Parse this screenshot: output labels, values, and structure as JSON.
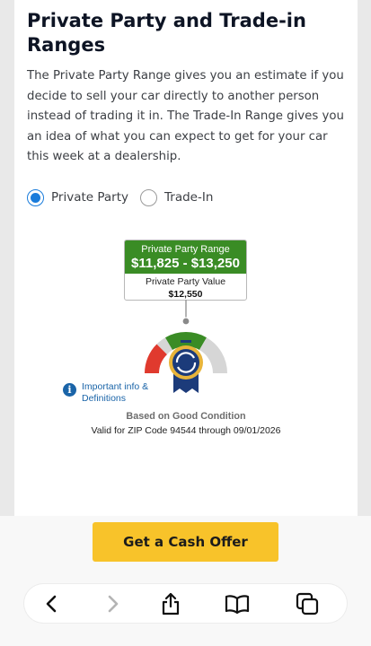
{
  "article": {
    "title": "Private Party and Trade-in Ranges",
    "description": "The Private Party Range gives you an estimate if you decide to sell your car directly to another person instead of trading it in. The Trade-In Range gives you an idea of what you can expect to get for your car this week at a dealership."
  },
  "options": [
    {
      "label": "Private Party",
      "selected": true
    },
    {
      "label": "Trade-In",
      "selected": false
    }
  ],
  "valuation": {
    "range_label": "Private Party Range",
    "range_value": "$11,825 - $13,250",
    "value_label": "Private Party Value",
    "value": "$12,550"
  },
  "info_link": "Important info & Definitions",
  "condition": "Based on Good Condition",
  "validity": "Valid for ZIP Code 94544 through 09/01/2026",
  "cta": {
    "label": "Get a Cash Offer"
  },
  "colors": {
    "range_green": "#3a8c25",
    "selected_blue": "#1a7cdb",
    "cta_yellow": "#f8c32a",
    "gauge_red": "#e03a2e",
    "gauge_green": "#3a8c25",
    "gauge_gray": "#d6d6d6",
    "ribbon_navy": "#1c3b7a"
  },
  "toolbar": {
    "icons": [
      "back-icon",
      "forward-icon",
      "share-icon",
      "bookmarks-icon",
      "tabs-icon"
    ]
  }
}
